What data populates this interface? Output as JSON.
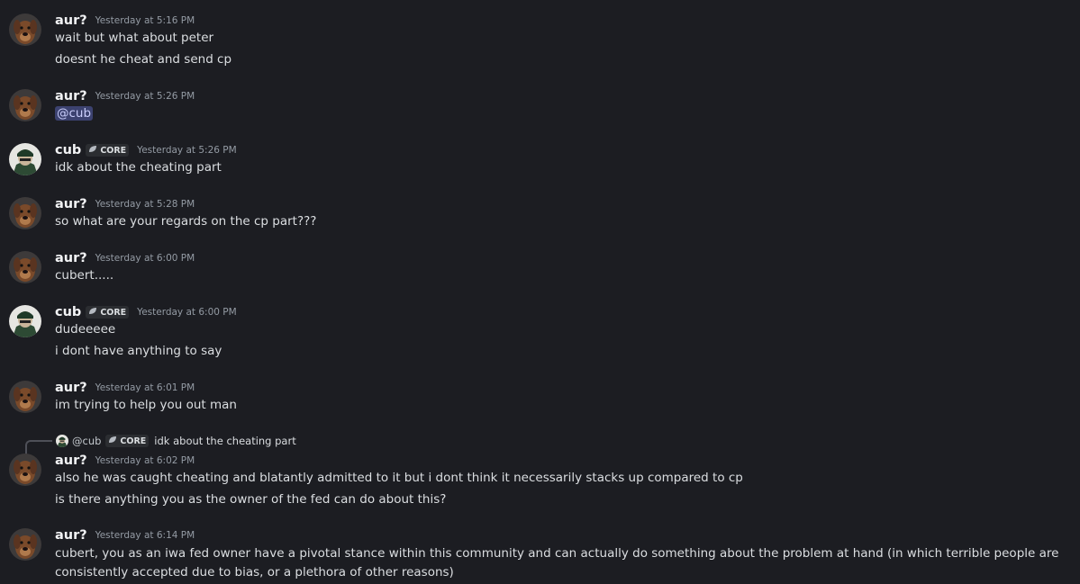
{
  "colors": {
    "background": "#1c1d22",
    "text": "#dbdee1",
    "timestamp": "#949ba4",
    "mention_bg": "#3c4270"
  },
  "users": {
    "aur": {
      "name": "aur?",
      "avatar": "dog-avatar"
    },
    "cub": {
      "name": "cub",
      "avatar": "character-avatar",
      "tag": "CORE",
      "tag_icon": "leaf-icon"
    }
  },
  "messages": [
    {
      "author": "aur?",
      "time": "Yesterday at 5:16 PM",
      "lines": [
        "wait but what about peter",
        "doesnt he cheat and send cp"
      ]
    },
    {
      "author": "aur?",
      "time": "Yesterday at 5:26 PM",
      "mention": "@cub"
    },
    {
      "author": "cub",
      "tag": "CORE",
      "time": "Yesterday at 5:26 PM",
      "lines": [
        "idk about the cheating part"
      ]
    },
    {
      "author": "aur?",
      "time": "Yesterday at 5:28 PM",
      "lines": [
        "so what are your regards on the cp part???"
      ]
    },
    {
      "author": "aur?",
      "time": "Yesterday at 6:00 PM",
      "lines": [
        "cubert....."
      ]
    },
    {
      "author": "cub",
      "tag": "CORE",
      "time": "Yesterday at 6:00 PM",
      "lines": [
        "dudeeeee",
        "i dont have anything to say"
      ]
    },
    {
      "author": "aur?",
      "time": "Yesterday at 6:01 PM",
      "lines": [
        "im trying to help you out man"
      ]
    },
    {
      "reply": {
        "user": "@cub",
        "tag": "CORE",
        "text": "idk about the cheating part"
      },
      "author": "aur?",
      "time": "Yesterday at 6:02 PM",
      "lines": [
        "also he was caught cheating and blatantly admitted to it but i dont think it necessarily stacks up compared to cp",
        "is there anything you as the owner of the fed can do about this?"
      ]
    },
    {
      "author": "aur?",
      "time": "Yesterday at 6:14 PM",
      "lines": [
        "cubert, you as an iwa fed owner have a pivotal stance within this community and can actually do something about the problem at hand (in which terrible people are consistently accepted due to bias, or a plethora of other reasons)"
      ]
    }
  ]
}
